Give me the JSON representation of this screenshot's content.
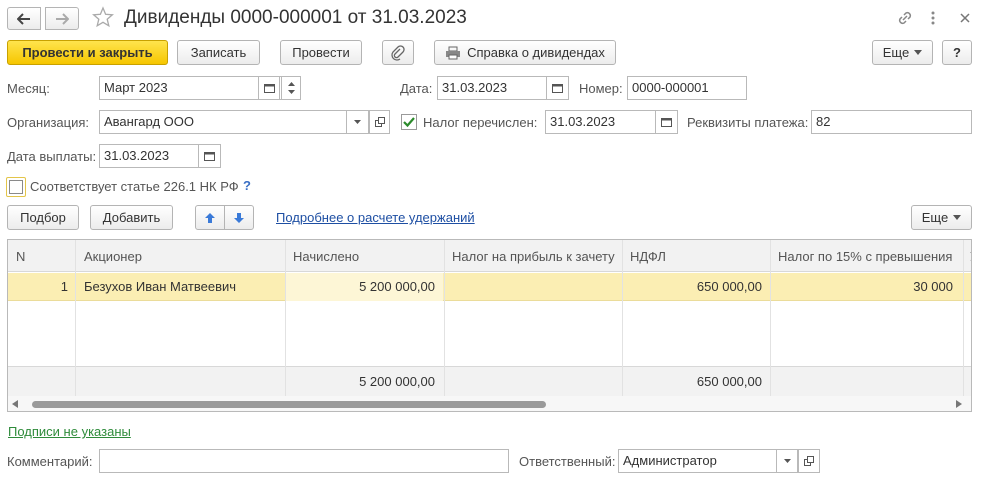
{
  "window": {
    "title": "Дивиденды 0000-000001 от 31.03.2023"
  },
  "toolbar": {
    "post_close_label": "Провести и закрыть",
    "save_label": "Записать",
    "post_label": "Провести",
    "certificate_label": "Справка о дивидендах",
    "more_label": "Еще",
    "help_label": "?"
  },
  "form": {
    "month_label": "Месяц:",
    "month_value": "Март 2023",
    "date_label": "Дата:",
    "date_value": "31.03.2023",
    "number_label": "Номер:",
    "number_value": "0000-000001",
    "org_label": "Организация:",
    "org_value": "Авангард ООО",
    "tax_transferred_label": "Налог перечислен:",
    "tax_transferred_date": "31.03.2023",
    "payment_details_label": "Реквизиты платежа:",
    "payment_details_value": "82",
    "payout_date_label": "Дата выплаты:",
    "payout_date_value": "31.03.2023",
    "article_label": "Соответствует статье 226.1 НК РФ",
    "article_help": "?"
  },
  "table_toolbar": {
    "select_label": "Подбор",
    "add_label": "Добавить",
    "details_link": "Подробнее о расчете удержаний",
    "more_label": "Еще"
  },
  "table": {
    "columns": [
      "N",
      "Акционер",
      "Начислено",
      "Налог на прибыль к зачету",
      "НДФЛ",
      "Налог по 15% с превышения"
    ],
    "rows": [
      {
        "n": "1",
        "shareholder": "Безухов Иван Матвеевич",
        "accrued": "5 200 000,00",
        "profit_tax": "",
        "ndfl": "650 000,00",
        "tax15": "30 000"
      }
    ],
    "totals": {
      "accrued": "5 200 000,00",
      "ndfl": "650 000,00"
    }
  },
  "footer": {
    "signatures_link": "Подписи не указаны",
    "comment_label": "Комментарий:",
    "comment_value": "",
    "responsible_label": "Ответственный:",
    "responsible_value": "Администратор"
  },
  "colors": {
    "primary_button": "#f6c600",
    "selected_row": "#fbeeb3",
    "signatures_link": "#2e8b3a",
    "link": "#1e4fa3"
  }
}
